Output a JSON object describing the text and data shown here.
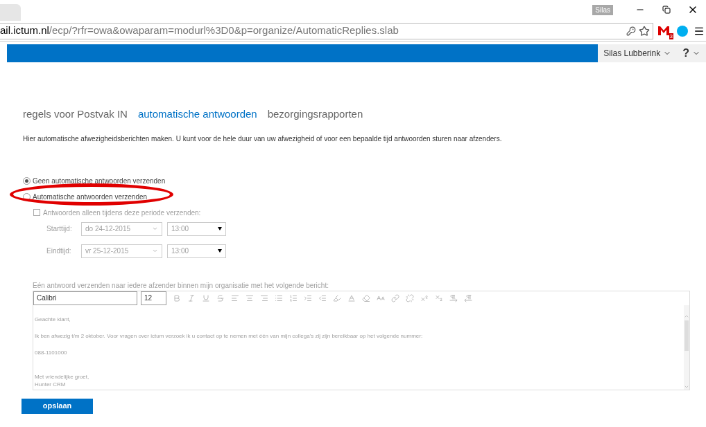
{
  "browser": {
    "profile": "Silas",
    "url": {
      "host": "ail.ictum.nl",
      "path": "/ecp/?rfr=owa&owaparam=modurl%3D0&p=organize/AutomaticReplies.slab"
    },
    "mail_badge": "3"
  },
  "header": {
    "user": "Silas Lubberink",
    "help": "?"
  },
  "tabs": [
    {
      "label": "regels voor Postvak IN",
      "selected": false
    },
    {
      "label": "automatische antwoorden",
      "selected": true
    },
    {
      "label": "bezorgingsrapporten",
      "selected": false
    }
  ],
  "description": "Hier automatische afwezigheidsberichten maken. U kunt voor de hele duur van uw afwezigheid of voor een bepaalde tijd antwoorden sturen naar afzenders.",
  "radios": [
    {
      "label": "Geen automatische antwoorden verzenden",
      "selected": true
    },
    {
      "label": "Automatische antwoorden verzenden",
      "selected": false
    }
  ],
  "period": {
    "label": "Antwoorden alleen tijdens deze periode verzenden:",
    "checked": false,
    "disabled": true,
    "rows": [
      {
        "label": "Starttijd:",
        "date": "do 24-12-2015",
        "time": "13:00"
      },
      {
        "label": "Eindtijd:",
        "date": "vr 25-12-2015",
        "time": "13:00"
      }
    ]
  },
  "message": {
    "label": "Eén antwoord verzenden naar iedere afzender binnen mijn organisatie met het volgende bericht:",
    "disabled": true,
    "font": "Calibri",
    "size": "12",
    "paragraphs": [
      [
        "Geachte klant,"
      ],
      [
        "Ik ben afwezig t/m 2 oktober. Voor vragen over ictum verzoek ik u contact op te nemen met één van mijn collega's zij zijn bereikbaar op het volgende nummer:"
      ],
      [
        "088-1101000"
      ],
      [
        "Met vriendelijke groet,",
        "Hunter CRM"
      ]
    ]
  },
  "save_button": "opslaan"
}
